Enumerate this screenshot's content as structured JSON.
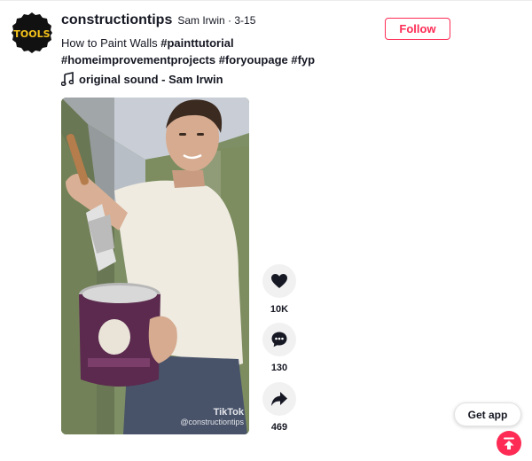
{
  "post": {
    "avatar_text": "TOOLS",
    "username": "constructiontips",
    "nickname": "Sam Irwin · 3-15",
    "description_text": "How to Paint Walls ",
    "hashtags": [
      "#painttutorial",
      "#homeimprovementprojects",
      "#foryoupage",
      "#fyp"
    ],
    "sound": "original sound - Sam Irwin",
    "follow_label": "Follow"
  },
  "video": {
    "watermark_brand": "TikTok",
    "watermark_handle": "@constructiontips"
  },
  "actions": {
    "likes": "10K",
    "comments": "130",
    "shares": "469"
  },
  "get_app_label": "Get app",
  "colors": {
    "accent": "#fe2c55",
    "text": "#161823",
    "action_bg": "#f1f1f2"
  },
  "icons": [
    "music-note-icon",
    "heart-icon",
    "comment-icon",
    "share-icon",
    "arrow-up-icon"
  ]
}
